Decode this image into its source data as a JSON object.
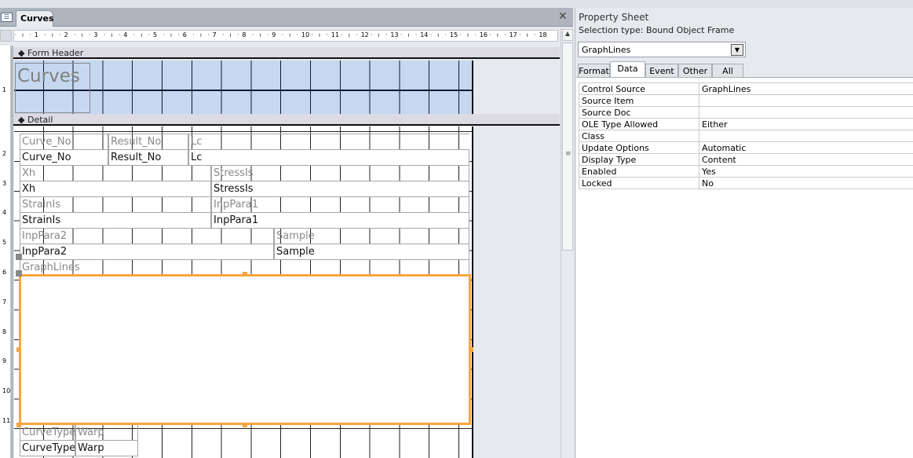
{
  "document_tab": {
    "title": "Curves",
    "icon": "form-icon"
  },
  "ruler": {
    "h_marks": [
      "1",
      "2",
      "3",
      "4",
      "5",
      "6",
      "7",
      "8",
      "9",
      "10",
      "11",
      "12",
      "13",
      "14",
      "15",
      "16",
      "17",
      "18"
    ],
    "v_marks": [
      "1",
      "2",
      "3",
      "4",
      "5",
      "6",
      "7",
      "8",
      "9",
      "10",
      "11"
    ]
  },
  "sections": {
    "header": "Form Header",
    "detail": "Detail"
  },
  "form_title": "Curves",
  "controls": {
    "curve_no_label": "Curve_No",
    "curve_no": "Curve_No",
    "result_no_label": "Result_No",
    "result_no": "Result_No",
    "lc_label": "Lc",
    "lc": "Lc",
    "xh_label": "Xh",
    "xh": "Xh",
    "stressis_label": "StressIs",
    "stressis": "StressIs",
    "strainis_label": "StrainIs",
    "strainis": "StrainIs",
    "inppara1_label": "InpPara1",
    "inppara1": "InpPara1",
    "inppara2_label": "InpPara2",
    "inppara2": "InpPara2",
    "sample_label": "Sample",
    "sample": "Sample",
    "graphlines_label": "GraphLines",
    "curvetype_label": "CurveType",
    "curvetype": "CurveType",
    "warp_label": "Warp",
    "warp": "Warp"
  },
  "selection_color": "#f7a540",
  "property_sheet": {
    "title": "Property Sheet",
    "selection_type": "Selection type:  Bound Object Frame",
    "selected_object": "GraphLines",
    "tabs": [
      "Format",
      "Data",
      "Event",
      "Other",
      "All"
    ],
    "active_tab": "Data",
    "properties": [
      {
        "name": "Control Source",
        "value": "GraphLines"
      },
      {
        "name": "Source Item",
        "value": ""
      },
      {
        "name": "Source Doc",
        "value": ""
      },
      {
        "name": "OLE Type Allowed",
        "value": "Either"
      },
      {
        "name": "Class",
        "value": ""
      },
      {
        "name": "Update Options",
        "value": "Automatic"
      },
      {
        "name": "Display Type",
        "value": "Content"
      },
      {
        "name": "Enabled",
        "value": "Yes"
      },
      {
        "name": "Locked",
        "value": "No"
      }
    ]
  }
}
